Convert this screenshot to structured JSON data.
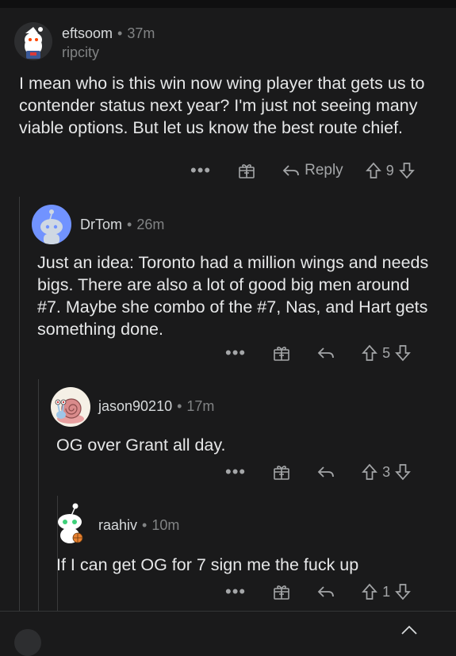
{
  "comments": [
    {
      "username": "eftsoom",
      "time": "37m",
      "flair": "ripcity",
      "body": "I mean who is this win now wing player that gets us to contender status next year? I'm just not seeing many viable options. But let us know the best route chief.",
      "reply_label": "Reply",
      "score": "9"
    },
    {
      "username": "DrTom",
      "time": "26m",
      "body": "Just an idea: Toronto had a million wings and needs bigs. There are also a lot of good big men around #7. Maybe she combo of the #7, Nas, and Hart gets something done.",
      "score": "5"
    },
    {
      "username": "jason90210",
      "time": "17m",
      "body": "OG over Grant all day.",
      "score": "3"
    },
    {
      "username": "raahiv",
      "time": "10m",
      "body": "If I can get OG for 7 sign me the fuck up",
      "score": "1"
    }
  ],
  "separator": "•",
  "more_glyph": "•••",
  "colors": {
    "background": "#1a1a1b",
    "text": "#d7dadc",
    "muted": "#818384",
    "thread_line": "#3a3b3c"
  },
  "icons": [
    "award-icon",
    "reply-arrow-icon",
    "upvote-icon",
    "downvote-icon",
    "more-icon",
    "close-icon"
  ]
}
